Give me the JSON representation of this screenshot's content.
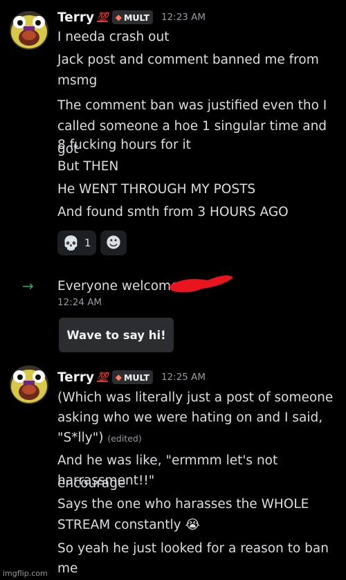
{
  "messages": [
    {
      "username": "Terry",
      "badge": "💯",
      "tag": "MULT",
      "timestamp": "12:23 AM",
      "lines": [
        "I needa crash out",
        "Jack post and comment banned me from",
        "msmg",
        "The comment ban was justified even tho I",
        "called someone a hoe 1 singular time and got",
        "8 fucking hours for it",
        "But THEN",
        "He WENT THROUGH MY POSTS",
        "And found smth from 3 HOURS AGO"
      ],
      "reactions": [
        {
          "emoji": "💀",
          "icon": "skull-icon",
          "count": "1"
        },
        {
          "emoji": "☻",
          "icon": "add-reaction-icon",
          "count": ""
        }
      ]
    },
    {
      "username": "Terry",
      "badge": "💯",
      "tag": "MULT",
      "timestamp": "12:25 AM",
      "lines": [
        "(Which was literally just a post of someone",
        "asking who we were hating on and I said,",
        "\"S*lly\")",
        "And he was like, \"ermmm let's not encourage",
        "harrassment!!\"",
        "Says the one who harasses the WHOLE",
        "STREAM constantly",
        "So yeah he just looked for a reason to ban",
        "me"
      ],
      "edited_label": "(edited)",
      "crying_emoji": "😭"
    }
  ],
  "system": {
    "text": "Everyone welcome",
    "timestamp": "12:24 AM",
    "button": "Wave to say hi!",
    "arrow_icon": "join-arrow-icon"
  },
  "watermark": "imgflip.com",
  "colors": {
    "background": "#000000",
    "text": "#dbdee1",
    "muted": "#949ba4",
    "join_arrow": "#23a55a",
    "redaction": "#e8151f"
  }
}
